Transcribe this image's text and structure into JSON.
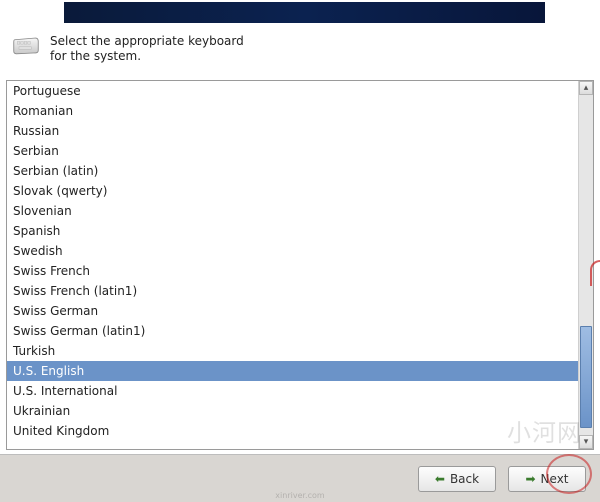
{
  "instruction": "Select the appropriate keyboard for the system.",
  "keyboards": [
    "Portuguese",
    "Romanian",
    "Russian",
    "Serbian",
    "Serbian (latin)",
    "Slovak (qwerty)",
    "Slovenian",
    "Spanish",
    "Swedish",
    "Swiss French",
    "Swiss French (latin1)",
    "Swiss German",
    "Swiss German (latin1)",
    "Turkish",
    "U.S. English",
    "U.S. International",
    "Ukrainian",
    "United Kingdom"
  ],
  "selected_index": 14,
  "buttons": {
    "back": "Back",
    "next": "Next"
  },
  "scroll": {
    "up_glyph": "▴",
    "down_glyph": "▾"
  },
  "icons": {
    "back_arrow": "⬅",
    "next_arrow": "➡"
  }
}
